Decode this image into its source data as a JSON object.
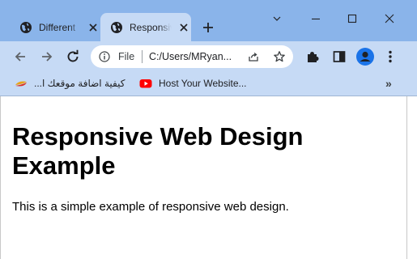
{
  "tabs": [
    {
      "title": "Different"
    },
    {
      "title": "Responsive"
    }
  ],
  "address_bar": {
    "scheme_label": "File",
    "url": "C:/Users/MRyan..."
  },
  "bookmarks": [
    {
      "label": "كيفية اضافة موقعك ا..."
    },
    {
      "label": "Host Your Website..."
    }
  ],
  "bookmarks_more": "»",
  "page": {
    "heading": "Responsive Web Design Example",
    "paragraph": "This is a simple example of responsive web design."
  },
  "colors": {
    "titlebar": "#8ab4ea",
    "toolbar": "#c6daf5",
    "avatar": "#1a73e8",
    "youtube": "#ff0000"
  },
  "icons": [
    "globe-icon",
    "close-icon",
    "plus-icon",
    "chevron-down-icon",
    "minimize-icon",
    "maximize-icon",
    "window-close-icon",
    "back-arrow-icon",
    "forward-arrow-icon",
    "reload-icon",
    "info-icon",
    "share-icon",
    "star-icon",
    "extensions-icon",
    "side-panel-icon",
    "profile-icon",
    "menu-icon",
    "youtube-icon"
  ]
}
